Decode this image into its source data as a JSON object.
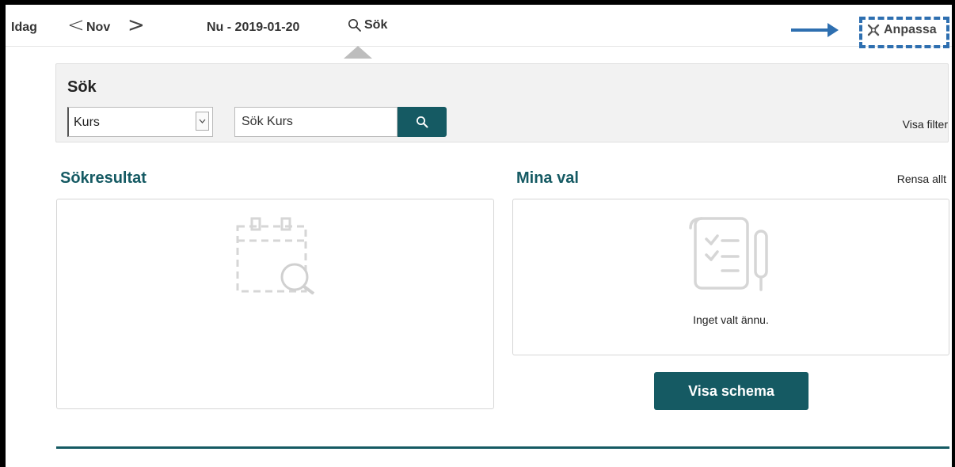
{
  "nav": {
    "today": "Idag",
    "prev_symbol": "<",
    "month": "Nov",
    "next_symbol": ">",
    "now_label": "Nu - 2019-01-20",
    "search_label": "Sök",
    "customize_label": "Anpassa"
  },
  "search": {
    "title": "Sök",
    "type_selected": "Kurs",
    "input_placeholder": "Sök Kurs",
    "show_filter": "Visa filter"
  },
  "results": {
    "heading": "Sökresultat"
  },
  "my_choices": {
    "heading": "Mina val",
    "clear_all": "Rensa allt",
    "empty_text": "Inget valt ännu.",
    "show_schedule": "Visa schema"
  },
  "colors": {
    "accent": "#155a63",
    "annotation": "#2e6fb0"
  },
  "icons": [
    "chevron-left-icon",
    "chevron-right-icon",
    "search-icon",
    "tools-icon",
    "chevron-down-icon",
    "empty-search-icon",
    "empty-notes-icon"
  ]
}
